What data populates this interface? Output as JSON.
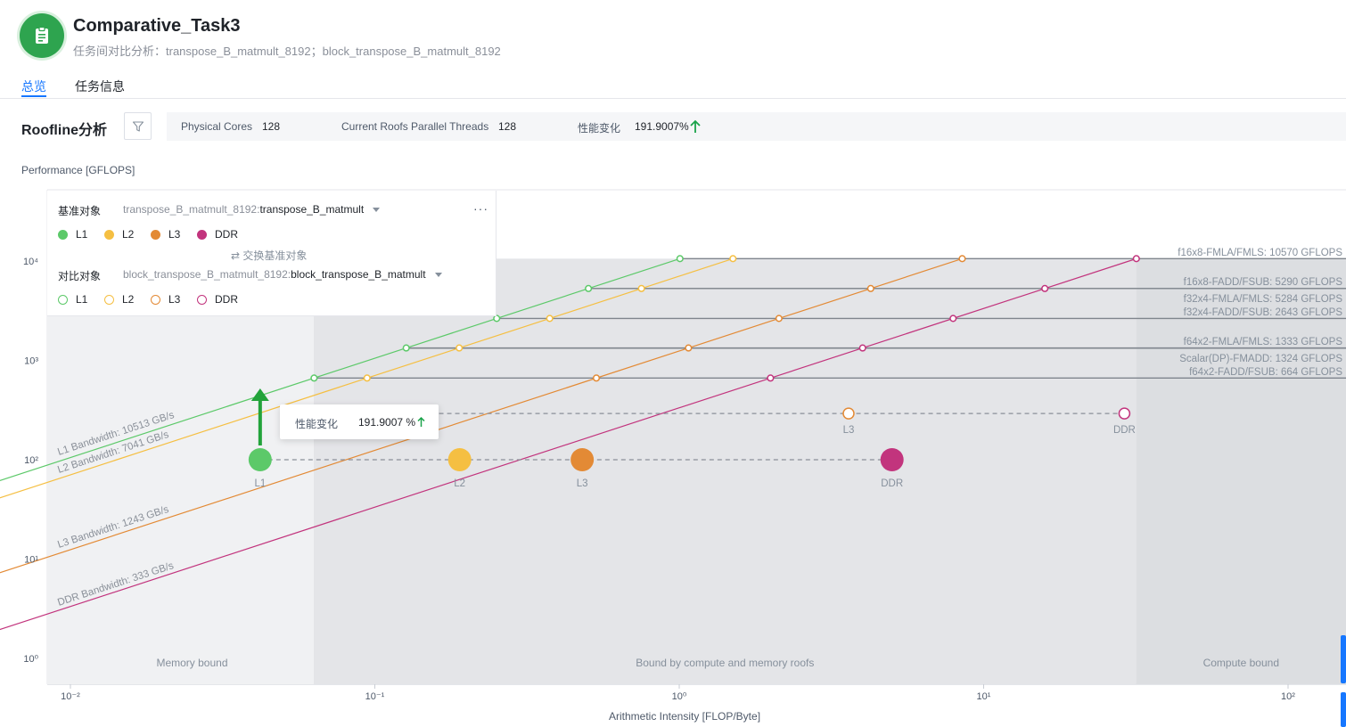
{
  "header": {
    "title": "Comparative_Task3",
    "subtitle": "任务间对比分析：transpose_B_matmult_8192；block_transpose_B_matmult_8192",
    "icon": "clipboard-icon"
  },
  "tabs": [
    {
      "label": "总览",
      "active": true
    },
    {
      "label": "任务信息",
      "active": false
    }
  ],
  "roofline": {
    "section_title": "Roofline分析",
    "info": {
      "physical_cores_label": "Physical Cores",
      "physical_cores": "128",
      "threads_label": "Current Roofs Parallel Threads",
      "threads": "128",
      "perf_change_label": "性能变化",
      "perf_change": "191.9007%"
    },
    "legend": {
      "baseline_label": "基准对象",
      "baseline_task": "transpose_B_matmult_8192:",
      "baseline_func": "transpose_B_matmult",
      "compare_label": "对比对象",
      "compare_task": "block_transpose_B_matmult_8192:",
      "compare_func": "block_transpose_B_matmult",
      "swap_label": "交换基准对象",
      "items": [
        "L1",
        "L2",
        "L3",
        "DDR"
      ]
    },
    "tooltip": {
      "label": "性能变化",
      "value": "191.9007 %"
    }
  },
  "chart_data": {
    "type": "scatter",
    "xscale": "log",
    "yscale": "log",
    "xlim": [
      0.01,
      200
    ],
    "ylim": [
      1,
      20000
    ],
    "xlabel": "Arithmetic Intensity [FLOP/Byte]",
    "ylabel": "Performance [GFLOPS]",
    "x_ticks": [
      "10⁻²",
      "10⁻¹",
      "10⁰",
      "10¹",
      "10²"
    ],
    "y_ticks": [
      "10⁰",
      "10¹",
      "10²",
      "10³",
      "10⁴"
    ],
    "colors": {
      "L1": "#5cc969",
      "L2": "#f5bf42",
      "L3": "#e38a35",
      "DDR": "#c2347d"
    },
    "bandwidths": [
      {
        "level": "L1",
        "label": "L1 Bandwidth: 10513 GB/s",
        "gbps": 10513
      },
      {
        "level": "L2",
        "label": "L2 Bandwidth: 7041 GB/s",
        "gbps": 7041
      },
      {
        "level": "L3",
        "label": "L3 Bandwidth: 1243 GB/s",
        "gbps": 1243
      },
      {
        "level": "DDR",
        "label": "DDR Bandwidth: 333 GB/s",
        "gbps": 333
      }
    ],
    "compute_roofs": [
      {
        "label": "f16x8-FMLA/FMLS: 10570 GFLOPS",
        "gflops": 10570
      },
      {
        "label": "f16x8-FADD/FSUB: 5290 GFLOPS",
        "gflops": 5290
      },
      {
        "label": "f32x4-FMLA/FMLS: 5284 GFLOPS",
        "gflops": 5284
      },
      {
        "label": "f32x4-FADD/FSUB: 2643 GFLOPS",
        "gflops": 2643
      },
      {
        "label": "f64x2-FMLA/FMLS: 1333 GFLOPS",
        "gflops": 1333
      },
      {
        "label": "Scalar(DP)-FMADD: 1324 GFLOPS",
        "gflops": 1324
      },
      {
        "label": "f64x2-FADD/FSUB: 664 GFLOPS",
        "gflops": 664
      }
    ],
    "regions": [
      {
        "label": "Memory bound",
        "x_from": 0.01,
        "x_to": 0.063
      },
      {
        "label": "Bound by compute and memory roofs",
        "x_from": 0.063,
        "x_to": 31.7
      },
      {
        "label": "Compute bound",
        "x_from": 31.7,
        "x_to": 200
      }
    ],
    "baseline_points": [
      {
        "level": "L1",
        "x": 0.042,
        "y": 100
      },
      {
        "level": "L2",
        "x": 0.19,
        "y": 100
      },
      {
        "level": "L3",
        "x": 0.48,
        "y": 100
      },
      {
        "level": "DDR",
        "x": 5.0,
        "y": 100
      }
    ],
    "compare_points": [
      {
        "level": "L3",
        "x": 3.6,
        "y": 292
      },
      {
        "level": "DDR",
        "x": 29,
        "y": 292
      }
    ],
    "perf_change": "191.9007 %"
  }
}
